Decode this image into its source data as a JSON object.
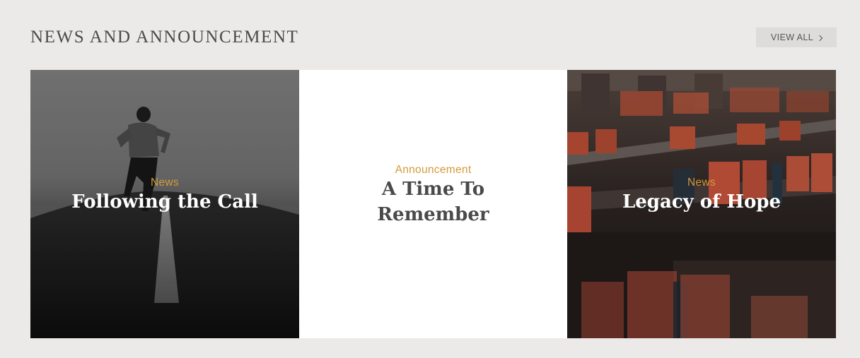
{
  "section": {
    "title": "NEWS AND ANNOUNCEMENT",
    "view_all_label": "VIEW ALL"
  },
  "cards": [
    {
      "category": "News",
      "title": "Following the Call"
    },
    {
      "category": "Announcement",
      "title": "A Time To Remember"
    },
    {
      "category": "News",
      "title": "Legacy of Hope"
    }
  ],
  "colors": {
    "page_background": "#ECEAE8",
    "category_accent": "#D39B3C",
    "heading_text": "#4a4a4a",
    "button_background": "#DEDCDA"
  },
  "icons": {
    "view_all": "chevron-right-icon"
  }
}
